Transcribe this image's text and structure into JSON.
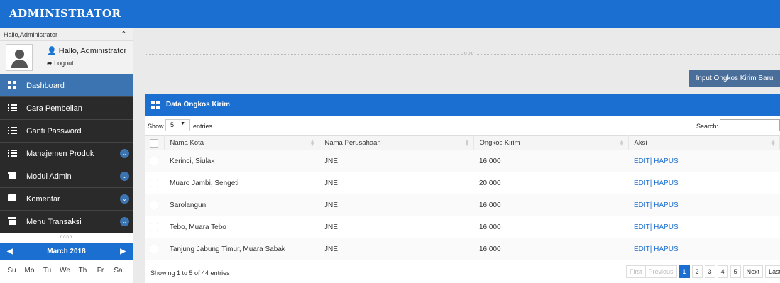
{
  "header": {
    "brand": "ADMINISTRATOR"
  },
  "sidebar": {
    "hello_bar": "Hallo,Administrator",
    "user_name": "Hallo, Administrator",
    "logout_label": "Logout",
    "menu": [
      {
        "label": "Dashboard",
        "icon": "grid-icon",
        "active": true,
        "submenu": false
      },
      {
        "label": "Cara Pembelian",
        "icon": "list-icon",
        "active": false,
        "submenu": false
      },
      {
        "label": "Ganti Password",
        "icon": "list-icon",
        "active": false,
        "submenu": false
      },
      {
        "label": "Manajemen Produk",
        "icon": "list-icon",
        "active": false,
        "submenu": true
      },
      {
        "label": "Modul Admin",
        "icon": "archive-icon",
        "active": false,
        "submenu": true
      },
      {
        "label": "Komentar",
        "icon": "comment-icon",
        "active": false,
        "submenu": true
      },
      {
        "label": "Menu Transaksi",
        "icon": "archive-icon",
        "active": false,
        "submenu": true
      }
    ],
    "calendar": {
      "month": "March 2018",
      "days": [
        "Su",
        "Mo",
        "Tu",
        "We",
        "Th",
        "Fr",
        "Sa"
      ]
    }
  },
  "main": {
    "new_button": "Input Ongkos Kirim Baru",
    "panel_title": "Data Ongkos Kirim",
    "show_label": "Show",
    "length_value": "5",
    "entries_label": "entries",
    "search_label": "Search:",
    "search_value": "",
    "columns": [
      "Nama Kota",
      "Nama Perusahaan",
      "Ongkos Kirim",
      "Aksi"
    ],
    "rows": [
      {
        "kota": "Kerinci, Siulak",
        "perusahaan": "JNE",
        "ongkos": "16.000",
        "aksi": "EDIT| HAPUS"
      },
      {
        "kota": "Muaro Jambi, Sengeti",
        "perusahaan": "JNE",
        "ongkos": "20.000",
        "aksi": "EDIT| HAPUS"
      },
      {
        "kota": "Sarolangun",
        "perusahaan": "JNE",
        "ongkos": "16.000",
        "aksi": "EDIT| HAPUS"
      },
      {
        "kota": "Tebo, Muara Tebo",
        "perusahaan": "JNE",
        "ongkos": "16.000",
        "aksi": "EDIT| HAPUS"
      },
      {
        "kota": "Tanjung Jabung Timur, Muara Sabak",
        "perusahaan": "JNE",
        "ongkos": "16.000",
        "aksi": "EDIT| HAPUS"
      }
    ],
    "info": "Showing 1 to 5 of 44 entries",
    "pager": {
      "first": "First",
      "previous": "Previous",
      "pages": [
        "1",
        "2",
        "3",
        "4",
        "5"
      ],
      "current": "1",
      "next": "Next",
      "last": "Last"
    }
  },
  "colors": {
    "primary": "#1b6fd1",
    "sidebar_dark": "#2a2a2a",
    "active_item": "#3b74b0",
    "button": "#4a6e9a"
  }
}
